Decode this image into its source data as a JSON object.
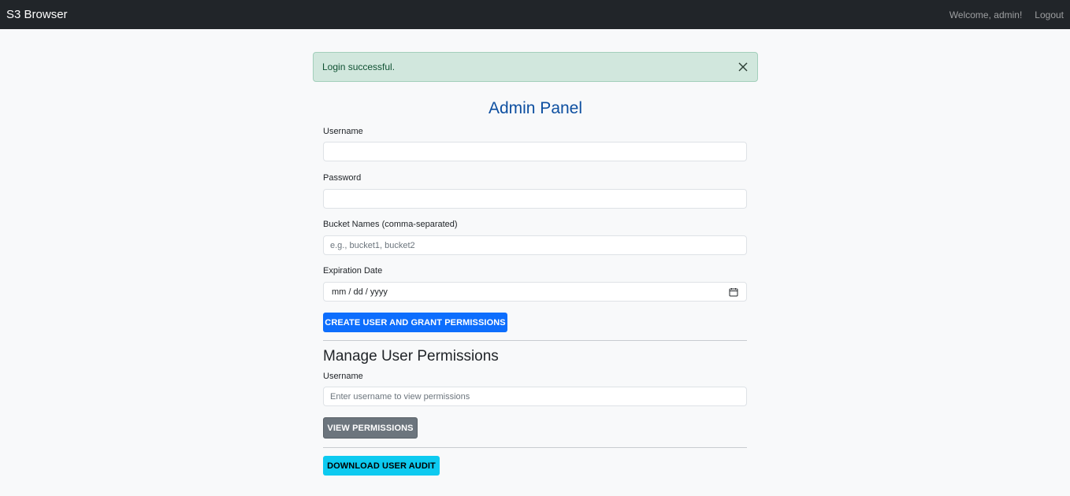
{
  "navbar": {
    "brand": "S3 Browser",
    "welcome": "Welcome, admin!",
    "logout": "Logout"
  },
  "alert": {
    "message": "Login successful."
  },
  "create_form": {
    "title": "Admin Panel",
    "username_label": "Username",
    "username_value": "",
    "password_label": "Password",
    "password_value": "",
    "buckets_label": "Bucket Names (comma-separated)",
    "buckets_placeholder": "e.g., bucket1, bucket2",
    "expiration_label": "Expiration Date",
    "expiration_placeholder": "mm / dd / yyyy",
    "submit_label": "CREATE USER AND GRANT PERMISSIONS"
  },
  "manage": {
    "title": "Manage User Permissions",
    "username_label": "Username",
    "username_placeholder": "Enter username to view permissions",
    "view_label": "VIEW PERMISSIONS"
  },
  "audit": {
    "download_label": "DOWNLOAD USER AUDIT"
  },
  "colors": {
    "navbar_bg": "#212529",
    "alert_bg": "#d1e7dd",
    "title": "#0d4fa0",
    "primary": "#0d6efd",
    "secondary": "#6c757d",
    "info": "#0dcaf0"
  },
  "icons": {
    "alert_close": "close-icon",
    "date_picker": "calendar-icon"
  }
}
